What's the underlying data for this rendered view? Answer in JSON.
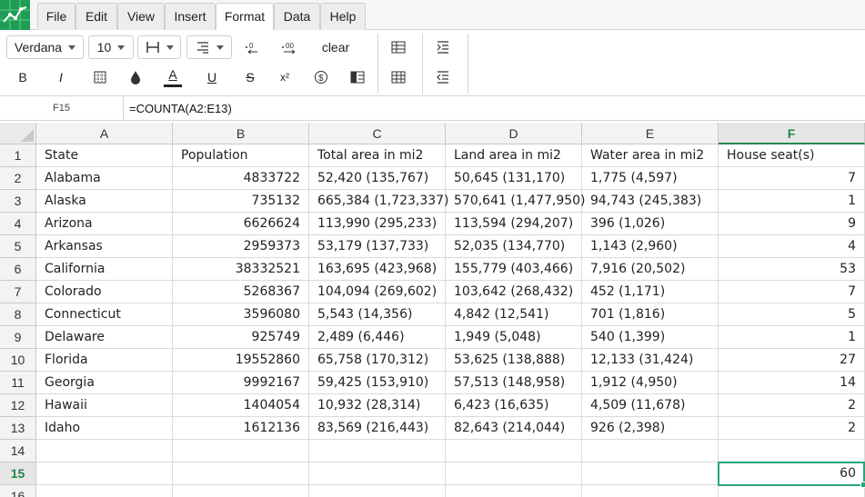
{
  "menu": [
    {
      "label": "File"
    },
    {
      "label": "Edit"
    },
    {
      "label": "View"
    },
    {
      "label": "Insert"
    },
    {
      "label": "Format"
    },
    {
      "label": "Data"
    },
    {
      "label": "Help"
    }
  ],
  "active_menu": "Format",
  "toolbar": {
    "font_family": "Verdana",
    "font_size": "10",
    "clear_label": "clear",
    "bold_label": "B",
    "italic_label": "I",
    "underline_label": "U",
    "strike_label": "S",
    "superscript_label": "x²",
    "font_color_label": "A"
  },
  "formula_bar": {
    "cell_ref": "F15",
    "formula": "=COUNTA(A2:E13)"
  },
  "colors": {
    "accent": "#1f8a4c",
    "selection": "#2aa57a"
  },
  "columns": [
    "A",
    "B",
    "C",
    "D",
    "E",
    "F"
  ],
  "active_column": "F",
  "rows": [
    "1",
    "2",
    "3",
    "4",
    "5",
    "6",
    "7",
    "8",
    "9",
    "10",
    "11",
    "12",
    "13",
    "14",
    "15",
    "16"
  ],
  "active_row": "15",
  "table": [
    [
      "State",
      "Population",
      "Total area in mi2",
      "Land area in mi2",
      "Water area in mi2",
      "House seat(s)"
    ],
    [
      "Alabama",
      "4833722",
      "52,420 (135,767)",
      "50,645 (131,170)",
      "1,775 (4,597)",
      "7"
    ],
    [
      "Alaska",
      "735132",
      "665,384 (1,723,337)",
      "570,641 (1,477,950)",
      "94,743 (245,383)",
      "1"
    ],
    [
      "Arizona",
      "6626624",
      "113,990 (295,233)",
      "113,594 (294,207)",
      "396 (1,026)",
      "9"
    ],
    [
      "Arkansas",
      "2959373",
      "53,179 (137,733)",
      "52,035 (134,770)",
      "1,143 (2,960)",
      "4"
    ],
    [
      "California",
      "38332521",
      "163,695 (423,968)",
      "155,779 (403,466)",
      "7,916 (20,502)",
      "53"
    ],
    [
      "Colorado",
      "5268367",
      "104,094 (269,602)",
      "103,642 (268,432)",
      "452 (1,171)",
      "7"
    ],
    [
      "Connecticut",
      "3596080",
      "5,543 (14,356)",
      "4,842 (12,541)",
      "701 (1,816)",
      "5"
    ],
    [
      "Delaware",
      "925749",
      "2,489 (6,446)",
      "1,949 (5,048)",
      "540 (1,399)",
      "1"
    ],
    [
      "Florida",
      "19552860",
      "65,758 (170,312)",
      "53,625 (138,888)",
      "12,133 (31,424)",
      "27"
    ],
    [
      "Georgia",
      "9992167",
      "59,425 (153,910)",
      "57,513 (148,958)",
      "1,912 (4,950)",
      "14"
    ],
    [
      "Hawaii",
      "1404054",
      "10,932 (28,314)",
      "6,423 (16,635)",
      "4,509 (11,678)",
      "2"
    ],
    [
      "Idaho",
      "1612136",
      "83,569 (216,443)",
      "82,643 (214,044)",
      "926 (2,398)",
      "2"
    ],
    [
      "",
      "",
      "",
      "",
      "",
      ""
    ],
    [
      "",
      "",
      "",
      "",
      "",
      "60"
    ],
    [
      "",
      "",
      "",
      "",
      "",
      ""
    ]
  ]
}
